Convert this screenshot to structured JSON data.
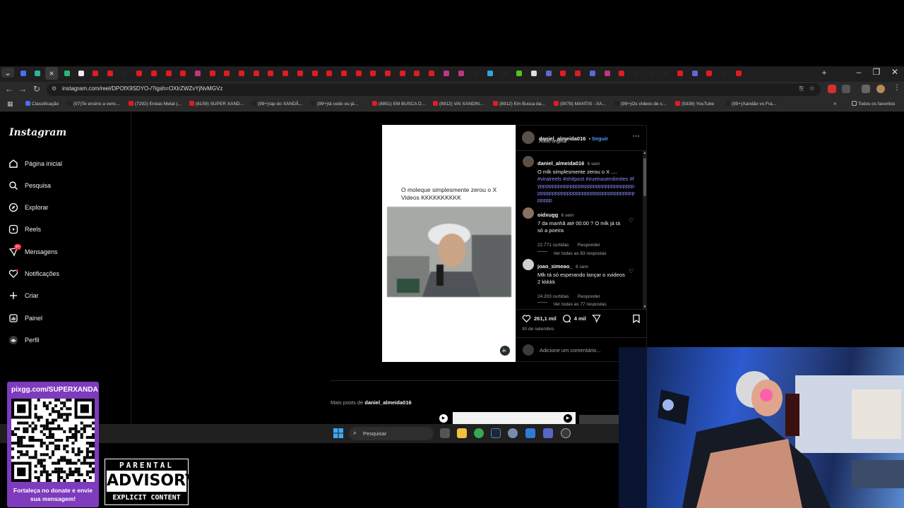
{
  "browser": {
    "url": "instagram.com/reel/DPOfX9SDYO-/?igsh=OXlrZWZvYjNvMGVz",
    "bookmarks": [
      "Classificação",
      "(97)Te ensino a venc...",
      "(7292) Enéas Metal |...",
      "(8159) SUPER XAND...",
      "(99+)rap do XANDÃ...",
      "(99+)tá cedo ou já...",
      "(8851) EM BUSCA D...",
      "(8912) VAI XANDIN...",
      "(8912) Em Busca da...",
      "(9078) MANTIS - XA...",
      "(99+)Os vídeos de c...",
      "(9338) YouTube",
      "(99+)Xandão vs Fra..."
    ],
    "all_bookmarks_label": "Todos os favoritos"
  },
  "instagram": {
    "logo": "Instagram",
    "nav": [
      {
        "label": "Página inicial",
        "icon": "home-icon"
      },
      {
        "label": "Pesquisa",
        "icon": "search-icon"
      },
      {
        "label": "Explorar",
        "icon": "compass-icon"
      },
      {
        "label": "Reels",
        "icon": "reels-icon"
      },
      {
        "label": "Mensagens",
        "icon": "messenger-icon",
        "badge": "9+"
      },
      {
        "label": "Notificações",
        "icon": "heart-icon"
      },
      {
        "label": "Criar",
        "icon": "plus-icon"
      },
      {
        "label": "Painel",
        "icon": "dashboard-icon"
      },
      {
        "label": "Perfil",
        "icon": "profile-avatar"
      }
    ]
  },
  "reel": {
    "caption": "O moleque simplesmente zerou o X Videos KKKKKKKKKK",
    "author": "daniel_almeida016",
    "follow": "Seguir",
    "audio": "Áudio original",
    "post_comment": {
      "user": "daniel_almeida016",
      "time": "6 sem",
      "text": "O mlk simplesmente zerou o X ....",
      "hashtags": "#viralreels #shitpost #zueirasemlimites #fypppppppppppppppppppppppppppppppppppppppppppppppppppppppppppppppppppppp"
    },
    "comments": [
      {
        "user": "oidxugg",
        "time": "6 sem",
        "text": "7 da manhã até 00:00 ? O mlk já tá só a poeira",
        "likes": "22.771 curtidas",
        "reply": "Responder",
        "view_replies": "Ver todas as 83 respostas"
      },
      {
        "user": "joao_simeao_",
        "time": "6 sem",
        "text": "Mlk tá só esperando lançar o xvideos 2 kkkkk",
        "likes": "24.203 curtidas",
        "reply": "Responder",
        "view_replies": "Ver todas as 77 respostas"
      }
    ],
    "likes": "261,1 mil",
    "comments_count": "4 mil",
    "date": "30 de setembro",
    "add_comment_placeholder": "Adicione um comentário...",
    "more_posts_prefix": "Mais posts de",
    "more_posts_user": "daniel_almeida016"
  },
  "taskbar": {
    "search_label": "Pesquisar"
  },
  "overlays": {
    "pix_url": "pixgg.com/SUPERXANDA",
    "pix_message": "Fortaleça no donate e envie sua mensagem!",
    "advisory_top": "PARENTAL",
    "advisory_mid": "ADVISORY",
    "advisory_bottom": "EXPLICIT CONTENT"
  },
  "colors": {
    "instagram_link": "#8c8cff",
    "follow_blue": "#4a9cff",
    "pix_purple": "#7e3bbd",
    "youtube_red": "#e01b24"
  }
}
